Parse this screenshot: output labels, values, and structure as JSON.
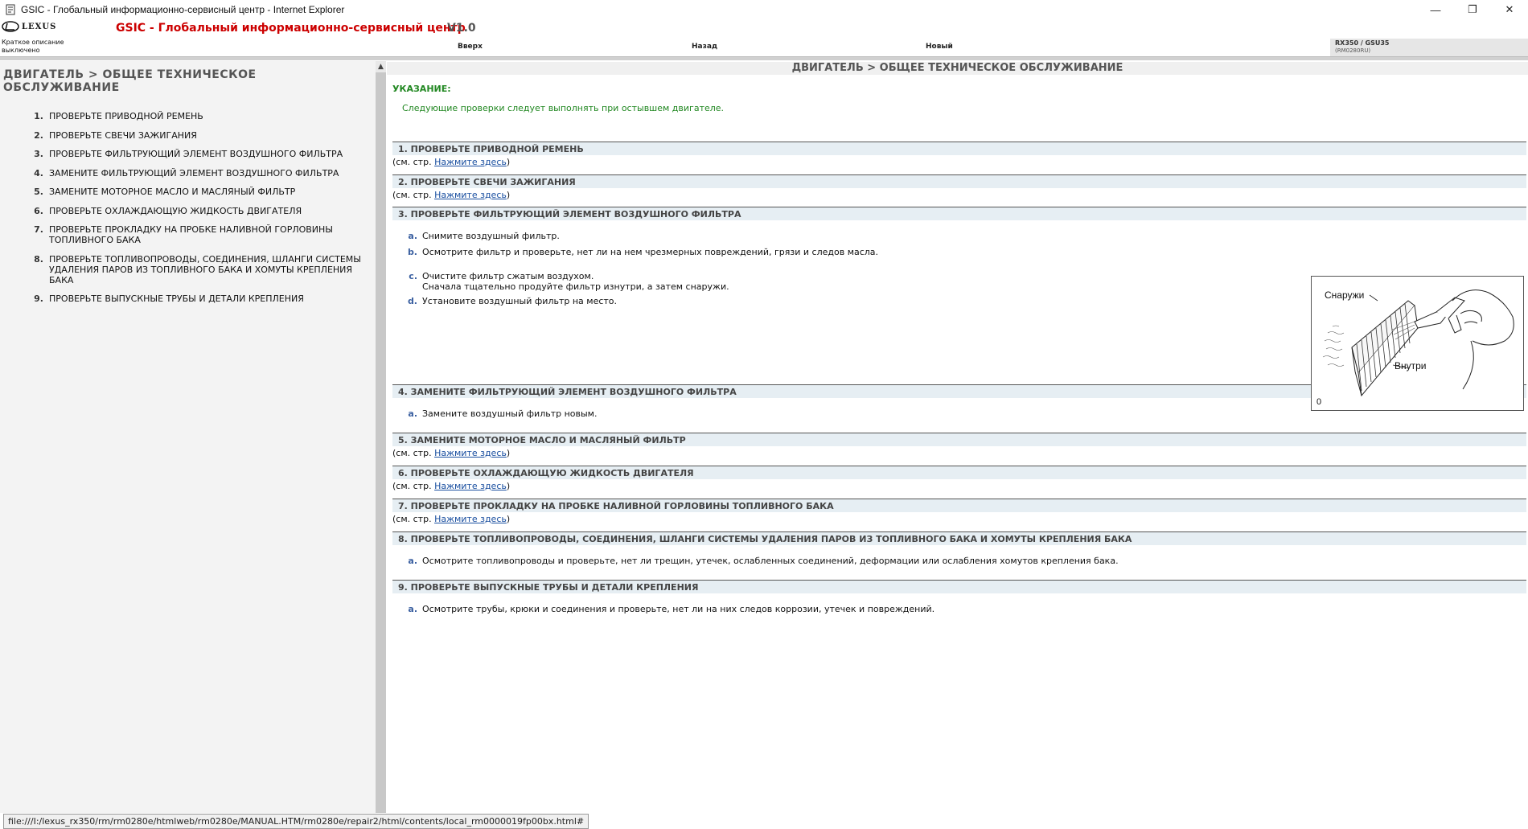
{
  "window": {
    "title": "GSIC - Глобальный информационно-сервисный центр - Internet Explorer",
    "minimize": "—",
    "restore": "❐",
    "close": "✕"
  },
  "header": {
    "logo_text": "LEXUS",
    "app_title": "GSIC - Глобальный информационно-сервисный центр",
    "version": "V1.0",
    "brief_desc_line1": "Краткое описание",
    "brief_desc_line2": "выключено",
    "nav": {
      "up": "Вверх",
      "back": "Назад",
      "new": "Новый"
    },
    "model": "RX350 / GSU35",
    "model_code": "(RM0280RU)"
  },
  "left": {
    "title": "ДВИГАТЕЛЬ > ОБЩЕЕ ТЕХНИЧЕСКОЕ ОБСЛУЖИВАНИЕ",
    "items": [
      {
        "num": "1.",
        "label": "ПРОВЕРЬТЕ ПРИВОДНОЙ РЕМЕНЬ"
      },
      {
        "num": "2.",
        "label": "ПРОВЕРЬТЕ СВЕЧИ ЗАЖИГАНИЯ"
      },
      {
        "num": "3.",
        "label": "ПРОВЕРЬТЕ ФИЛЬТРУЮЩИЙ ЭЛЕМЕНТ ВОЗДУШНОГО ФИЛЬТРА"
      },
      {
        "num": "4.",
        "label": "ЗАМЕНИТЕ ФИЛЬТРУЮЩИЙ ЭЛЕМЕНТ ВОЗДУШНОГО ФИЛЬТРА"
      },
      {
        "num": "5.",
        "label": "ЗАМЕНИТЕ МОТОРНОЕ МАСЛО И МАСЛЯНЫЙ ФИЛЬТР"
      },
      {
        "num": "6.",
        "label": "ПРОВЕРЬТЕ ОХЛАЖДАЮЩУЮ ЖИДКОСТЬ ДВИГАТЕЛЯ"
      },
      {
        "num": "7.",
        "label": "ПРОВЕРЬТЕ ПРОКЛАДКУ НА ПРОБКЕ НАЛИВНОЙ ГОРЛОВИНЫ ТОПЛИВНОГО БАКА"
      },
      {
        "num": "8.",
        "label": "ПРОВЕРЬТЕ ТОПЛИВОПРОВОДЫ, СОЕДИНЕНИЯ, ШЛАНГИ СИСТЕМЫ УДАЛЕНИЯ ПАРОВ ИЗ ТОПЛИВНОГО БАКА И ХОМУТЫ КРЕПЛЕНИЯ БАКА"
      },
      {
        "num": "9.",
        "label": "ПРОВЕРЬТЕ ВЫПУСКНЫЕ ТРУБЫ И ДЕТАЛИ КРЕПЛЕНИЯ"
      }
    ]
  },
  "right": {
    "title": "ДВИГАТЕЛЬ > ОБЩЕЕ ТЕХНИЧЕСКОЕ ОБСЛУЖИВАНИЕ",
    "note_label": "УКАЗАНИЕ:",
    "note_text": "Следующие проверки следует выполнять при остывшем двигателе.",
    "ref_prefix": "(см. стр. ",
    "ref_link": "Нажмите здесь",
    "ref_suffix": ")",
    "sections": [
      {
        "head": "1. ПРОВЕРЬТЕ ПРИВОДНОЙ РЕМЕНЬ"
      },
      {
        "head": "2. ПРОВЕРЬТЕ СВЕЧИ ЗАЖИГАНИЯ"
      },
      {
        "head": "3. ПРОВЕРЬТЕ ФИЛЬТРУЮЩИЙ ЭЛЕМЕНТ ВОЗДУШНОГО ФИЛЬТРА",
        "steps": [
          {
            "letter": "a.",
            "text": "Снимите воздушный фильтр."
          },
          {
            "letter": "b.",
            "text": "Осмотрите фильтр и проверьте, нет ли на нем чрезмерных повреждений, грязи и следов масла."
          },
          {
            "letter": "c.",
            "text": "Очистите фильтр сжатым воздухом.",
            "text2": "Сначала тщательно продуйте фильтр изнутри, а затем снаружи."
          },
          {
            "letter": "d.",
            "text": "Установите воздушный фильтр на место."
          }
        ]
      },
      {
        "head": "4. ЗАМЕНИТЕ ФИЛЬТРУЮЩИЙ ЭЛЕМЕНТ ВОЗДУШНОГО ФИЛЬТРА",
        "steps": [
          {
            "letter": "a.",
            "text": "Замените воздушный фильтр новым."
          }
        ]
      },
      {
        "head": "5. ЗАМЕНИТЕ МОТОРНОЕ МАСЛО И МАСЛЯНЫЙ ФИЛЬТР"
      },
      {
        "head": "6. ПРОВЕРЬТЕ ОХЛАЖДАЮЩУЮ ЖИДКОСТЬ ДВИГАТЕЛЯ"
      },
      {
        "head": "7. ПРОВЕРЬТЕ ПРОКЛАДКУ НА ПРОБКЕ НАЛИВНОЙ ГОРЛОВИНЫ ТОПЛИВНОГО БАКА"
      },
      {
        "head": "8. ПРОВЕРЬТЕ ТОПЛИВОПРОВОДЫ, СОЕДИНЕНИЯ, ШЛАНГИ СИСТЕМЫ УДАЛЕНИЯ ПАРОВ ИЗ ТОПЛИВНОГО БАКА И ХОМУТЫ КРЕПЛЕНИЯ БАКА",
        "steps": [
          {
            "letter": "a.",
            "text": "Осмотрите топливопроводы и проверьте, нет ли трещин, утечек, ослабленных соединений, деформации или ослабления хомутов крепления бака."
          }
        ]
      },
      {
        "head": "9. ПРОВЕРЬТЕ ВЫПУСКНЫЕ ТРУБЫ И ДЕТАЛИ КРЕПЛЕНИЯ",
        "steps": [
          {
            "letter": "a.",
            "text": "Осмотрите трубы, крюки и соединения и проверьте, нет ли на них следов коррозии, утечек и повреждений."
          }
        ]
      }
    ],
    "illustration": {
      "label_outside": "Снаружи",
      "label_inside": "Внутри",
      "label_id": "0"
    }
  },
  "statusbar": {
    "url": "file:///I:/lexus_rx350/rm/rm0280e/htmlweb/rm0280e/MANUAL.HTM/rm0280e/repair2/html/contents/local_rm0000019fp00bx.html#"
  }
}
